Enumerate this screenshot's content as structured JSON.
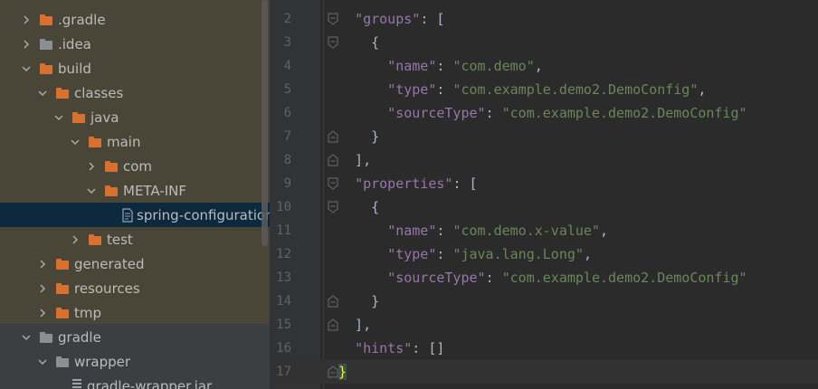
{
  "tree": {
    "items": [
      {
        "label": ".gradle",
        "icon": "folder-orange",
        "chevron": "right",
        "level": 0
      },
      {
        "label": ".idea",
        "icon": "folder-gray",
        "chevron": "right",
        "level": 0
      },
      {
        "label": "build",
        "icon": "folder-orange",
        "chevron": "down",
        "level": 0
      },
      {
        "label": "classes",
        "icon": "folder-orange",
        "chevron": "down",
        "level": 1
      },
      {
        "label": "java",
        "icon": "folder-orange",
        "chevron": "down",
        "level": 2
      },
      {
        "label": "main",
        "icon": "folder-orange",
        "chevron": "down",
        "level": 3
      },
      {
        "label": "com",
        "icon": "folder-orange",
        "chevron": "right",
        "level": 4
      },
      {
        "label": "META-INF",
        "icon": "folder-orange",
        "chevron": "down",
        "level": 4
      },
      {
        "label": "spring-configuration-",
        "icon": "json-file",
        "chevron": "none",
        "level": 5,
        "selected": true
      },
      {
        "label": "test",
        "icon": "folder-orange",
        "chevron": "right",
        "level": 3
      },
      {
        "label": "generated",
        "icon": "folder-orange",
        "chevron": "right",
        "level": 1
      },
      {
        "label": "resources",
        "icon": "folder-orange",
        "chevron": "right",
        "level": 1
      },
      {
        "label": "tmp",
        "icon": "folder-orange",
        "chevron": "right",
        "level": 1
      },
      {
        "label": "gradle",
        "icon": "folder-gray",
        "chevron": "down",
        "level": 0
      },
      {
        "label": "wrapper",
        "icon": "folder-gray",
        "chevron": "down",
        "level": 1
      },
      {
        "label": "gradle-wrapper.jar",
        "icon": "jar-file",
        "chevron": "none",
        "level": 2
      }
    ]
  },
  "editor": {
    "lines": [
      {
        "n": "2",
        "parts": [
          [
            "p",
            "  "
          ],
          [
            "k",
            "\"groups\""
          ],
          [
            "p",
            ": ["
          ]
        ]
      },
      {
        "n": "3",
        "parts": [
          [
            "p",
            "    {"
          ]
        ]
      },
      {
        "n": "4",
        "parts": [
          [
            "p",
            "      "
          ],
          [
            "k",
            "\"name\""
          ],
          [
            "p",
            ": "
          ],
          [
            "s",
            "\"com.demo\""
          ],
          [
            "p",
            ","
          ]
        ]
      },
      {
        "n": "5",
        "parts": [
          [
            "p",
            "      "
          ],
          [
            "k",
            "\"type\""
          ],
          [
            "p",
            ": "
          ],
          [
            "s",
            "\"com.example.demo2.DemoConfig\""
          ],
          [
            "p",
            ","
          ]
        ]
      },
      {
        "n": "6",
        "parts": [
          [
            "p",
            "      "
          ],
          [
            "k",
            "\"sourceType\""
          ],
          [
            "p",
            ": "
          ],
          [
            "s",
            "\"com.example.demo2.DemoConfig\""
          ]
        ]
      },
      {
        "n": "7",
        "parts": [
          [
            "p",
            "    }"
          ]
        ]
      },
      {
        "n": "8",
        "parts": [
          [
            "p",
            "  ],"
          ]
        ]
      },
      {
        "n": "9",
        "parts": [
          [
            "p",
            "  "
          ],
          [
            "k",
            "\"properties\""
          ],
          [
            "p",
            ": ["
          ]
        ]
      },
      {
        "n": "10",
        "parts": [
          [
            "p",
            "    {"
          ]
        ]
      },
      {
        "n": "11",
        "parts": [
          [
            "p",
            "      "
          ],
          [
            "k",
            "\"name\""
          ],
          [
            "p",
            ": "
          ],
          [
            "s",
            "\"com.demo.x-value\""
          ],
          [
            "p",
            ","
          ]
        ]
      },
      {
        "n": "12",
        "parts": [
          [
            "p",
            "      "
          ],
          [
            "k",
            "\"type\""
          ],
          [
            "p",
            ": "
          ],
          [
            "s",
            "\"java.lang.Long\""
          ],
          [
            "p",
            ","
          ]
        ]
      },
      {
        "n": "13",
        "parts": [
          [
            "p",
            "      "
          ],
          [
            "k",
            "\"sourceType\""
          ],
          [
            "p",
            ": "
          ],
          [
            "s",
            "\"com.example.demo2.DemoConfig\""
          ]
        ]
      },
      {
        "n": "14",
        "parts": [
          [
            "p",
            "    }"
          ]
        ]
      },
      {
        "n": "15",
        "parts": [
          [
            "p",
            "  ],"
          ]
        ]
      },
      {
        "n": "16",
        "parts": [
          [
            "p",
            "  "
          ],
          [
            "k",
            "\"hints\""
          ],
          [
            "p",
            ": []"
          ]
        ]
      },
      {
        "n": "17",
        "parts": [
          [
            "hl",
            "}"
          ]
        ],
        "current": true
      }
    ]
  },
  "colors": {
    "tree_bg": "#3c3f41",
    "tree_highlight_bg": "#4a4637",
    "selection": "#0d293e",
    "editor_bg": "#2b2b2b",
    "key": "#9876aa",
    "string": "#6a8759",
    "punct": "#a9b7c6"
  }
}
